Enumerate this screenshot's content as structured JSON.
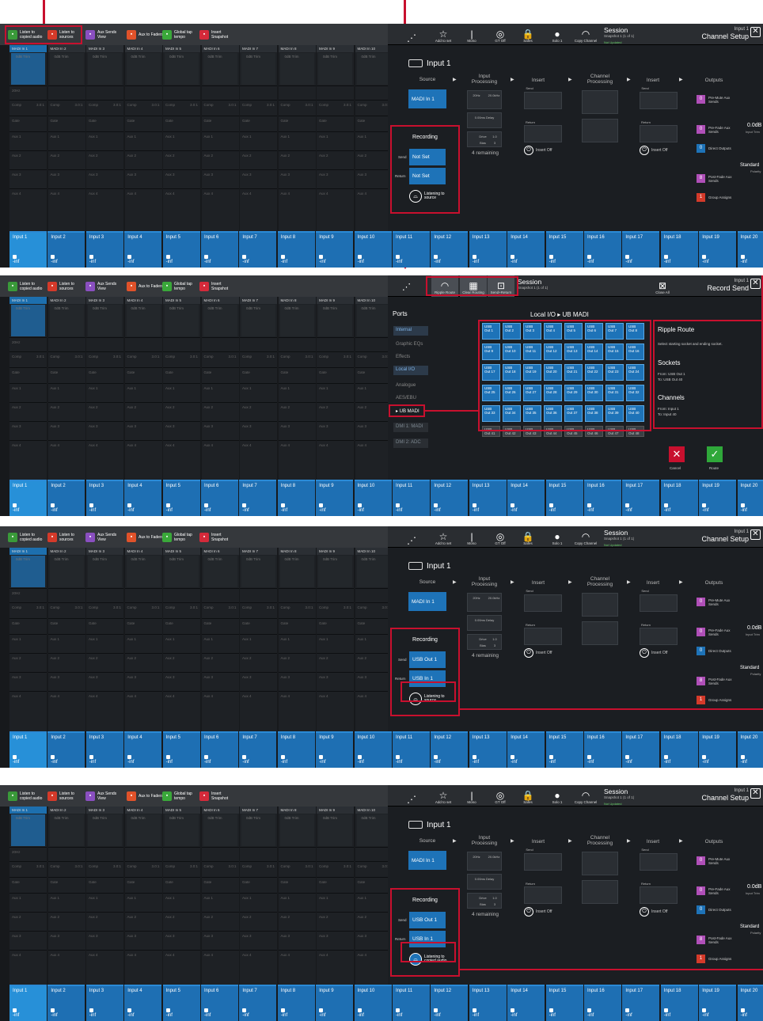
{
  "toolbar": {
    "buttons": [
      {
        "label": "Listen to copied audio",
        "color": "#3a9a3a",
        "icon": "tape-icon"
      },
      {
        "label": "Listen to sources",
        "color": "#d43a2a",
        "icon": "speaker-icon"
      },
      {
        "label": "Aux Sends View",
        "color": "#8a4fc0",
        "icon": "aux-icon"
      },
      {
        "label": "Aux to Faders",
        "color": "#e0522a",
        "icon": "faders-icon"
      },
      {
        "label": "Global tap tempo",
        "color": "#3aa83a",
        "icon": "tap-icon"
      },
      {
        "label": "Insert Snapshot",
        "color": "#d42a3a",
        "icon": "camera-icon"
      }
    ],
    "right": [
      {
        "label": "",
        "glyph": "⋰"
      },
      {
        "label": "Add to set",
        "glyph": "☆"
      },
      {
        "label": "Mono",
        "glyph": "|"
      },
      {
        "label": "GT Off",
        "glyph": "◎"
      },
      {
        "label": "Safes",
        "glyph": "🔒"
      },
      {
        "label": "Solo 1",
        "glyph": "●"
      },
      {
        "label": "Copy Channel",
        "glyph": "◠"
      }
    ],
    "routing_buttons": [
      {
        "label": "Ripple Route"
      },
      {
        "label": "Clear Routing"
      },
      {
        "label": "Send+Return"
      }
    ],
    "close_all": "Close All",
    "session_title": "Session",
    "snapshot": "Snapshot 1 (1 of 1)",
    "session_status": "Not Updated",
    "channel_title": "Input 1",
    "channel_setup": "Channel Setup",
    "record_send": "Record Send"
  },
  "strip_heads": [
    "MADI In 1",
    "MADI In 2",
    "MADI In 3",
    "MADI In 4",
    "MADI In 5",
    "MADI In 6",
    "MADI In 7",
    "MADI In 8",
    "MADI In 9",
    "MADI In 10"
  ],
  "trim": "0dB Trim",
  "hz": "20Hz",
  "comp": "Comp",
  "comp_val": "3.0:1",
  "gate": "Gate",
  "aux_labels": [
    "Aux 1",
    "Aux 2",
    "Aux 3",
    "Aux 4"
  ],
  "off": "off",
  "inputs": [
    "Input 1",
    "Input 2",
    "Input 3",
    "Input 4",
    "Input 5",
    "Input 6",
    "Input 7",
    "Input 8",
    "Input 9",
    "Input 10",
    "Input 11",
    "Input 12",
    "Input 13",
    "Input 14",
    "Input 15",
    "Input 16",
    "Input 17",
    "Input 18",
    "Input 19",
    "Input 20"
  ],
  "ninf": "-inf",
  "setup": {
    "title": "Input 1",
    "source": "Source",
    "source_value": "MADI In 1",
    "input_processing": "Input Processing",
    "insert": "Insert",
    "channel_processing": "Channel Processing",
    "outputs": "Outputs",
    "send": "Send",
    "return": "Return",
    "insert_off": "Insert Off",
    "delay": "0.00ms Delay",
    "delay2": "0.0ms",
    "remaining": "4 remaining",
    "drive": "Drive",
    "drive_val": "1.0",
    "bias": "Bias",
    "bias_val": "3",
    "hz_lo": "20Hz",
    "hz_hi": "20.0kHz",
    "level": "0.0dB",
    "input_trim": "Input Trim",
    "standard": "Standard",
    "polarity": "Polarity",
    "outs": [
      {
        "n": "0",
        "label": "Pre-Mute Aux Sends",
        "color": "#b04fb8"
      },
      {
        "n": "0",
        "label": "Pre-Fade Aux Sends",
        "color": "#b04fb8"
      },
      {
        "n": "0",
        "label": "Direct Outputs",
        "color": "#1e73b8"
      },
      {
        "n": "8",
        "label": "Post-Fade Aux Sends",
        "color": "#b04fb8"
      },
      {
        "n": "1",
        "label": "Group Assigns",
        "color": "#d43a2a"
      }
    ]
  },
  "rec1": {
    "title": "Recording",
    "send": "Send",
    "send_val": "Not Set",
    "ret": "Return",
    "ret_val": "Not Set",
    "listen": "Listening to source"
  },
  "rec3": {
    "title": "Recording",
    "send": "Send",
    "send_val": "USB Out 1",
    "ret": "Return",
    "ret_val": "USB In 1",
    "listen": "Listening to source"
  },
  "rec4": {
    "title": "Recording",
    "send": "Send",
    "send_val": "USB Out 1",
    "ret": "Return",
    "ret_val": "USB In 1",
    "listen": "Listening to copied audio"
  },
  "routing": {
    "ports_title": "Ports",
    "ports": [
      "Internal",
      "Graphic EQs",
      "Effects",
      "Local I/O",
      "Analogue",
      "AES/EBU",
      "▸ UB MADI",
      "DMI 1: MADI",
      "DMI 2: ADC"
    ],
    "breadcrumb": "Local I/O ▸ UB MADI",
    "sockets": [
      "USB Out 1",
      "USB Out 2",
      "USB Out 3",
      "USB Out 4",
      "USB Out 5",
      "USB Out 6",
      "USB Out 7",
      "USB Out 8",
      "USB Out 9",
      "USB Out 10",
      "USB Out 11",
      "USB Out 12",
      "USB Out 13",
      "USB Out 14",
      "USB Out 15",
      "USB Out 16",
      "USB Out 17",
      "USB Out 18",
      "USB Out 19",
      "USB Out 20",
      "USB Out 21",
      "USB Out 22",
      "USB Out 23",
      "USB Out 24",
      "USB Out 25",
      "USB Out 26",
      "USB Out 27",
      "USB Out 28",
      "USB Out 29",
      "USB Out 30",
      "USB Out 31",
      "USB Out 32",
      "USB Out 33",
      "USB Out 34",
      "USB Out 35",
      "USB Out 36",
      "USB Out 37",
      "USB Out 38",
      "USB Out 39",
      "USB Out 40",
      "USB Out 41",
      "USB Out 42",
      "USB Out 43",
      "USB Out 44",
      "USB Out 45",
      "USB Out 46",
      "USB Out 47",
      "USB Out 48"
    ],
    "ripple_title": "Ripple Route",
    "ripple_desc": "Select starting socket and ending socket.",
    "sockets_title": "Sockets",
    "sockets_from": "From: USB Out 1",
    "sockets_to": "To: USB Out 40",
    "channels_title": "Channels",
    "channels_from": "From: Input 1",
    "channels_to": "To: Input 40",
    "cancel": "Cancel",
    "route": "Route"
  }
}
